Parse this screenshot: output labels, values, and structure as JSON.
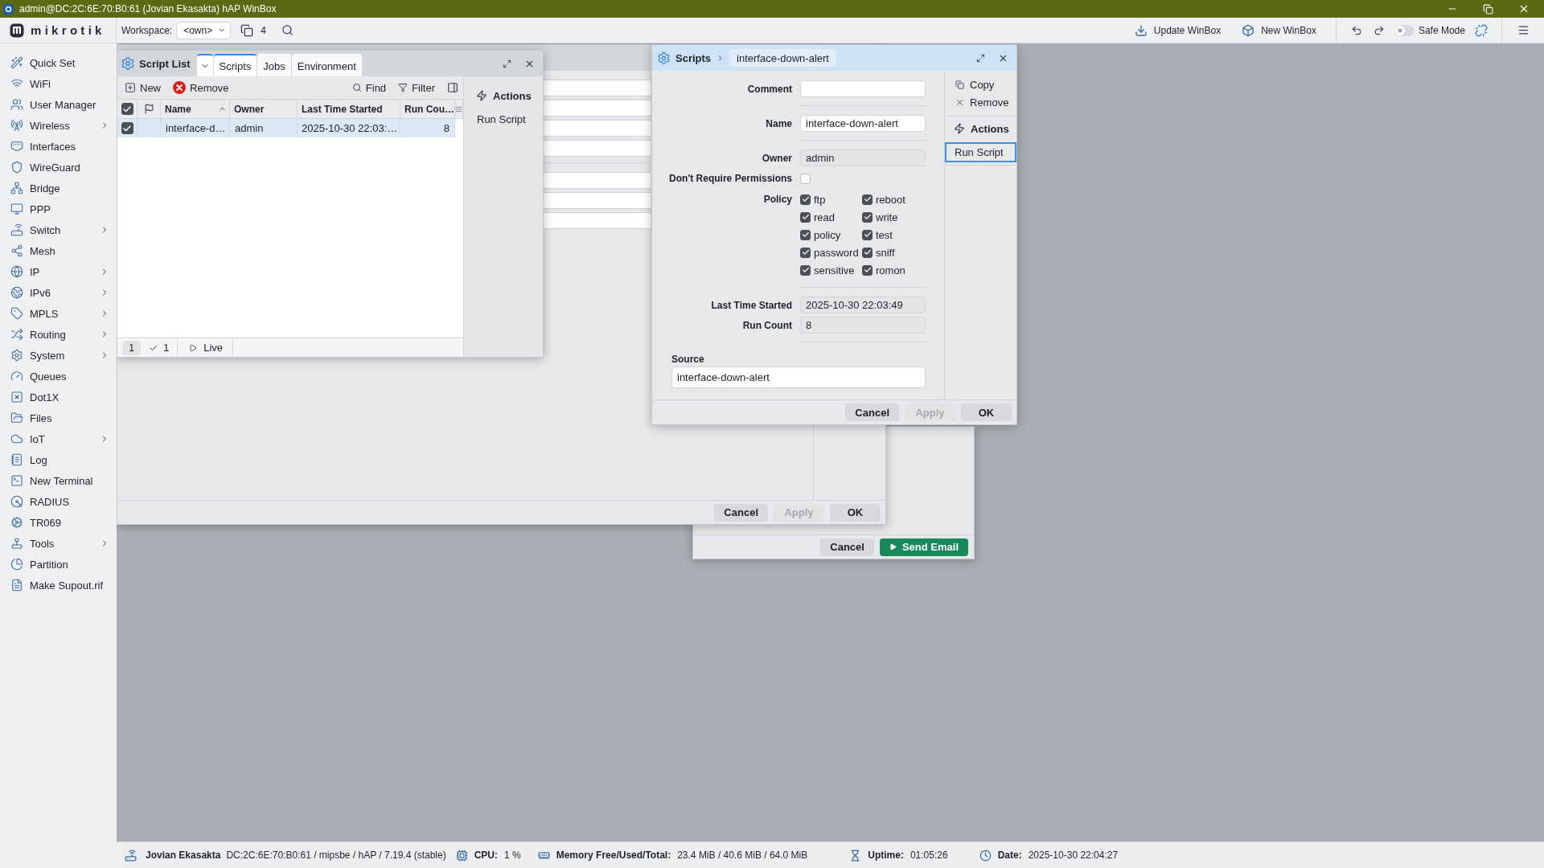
{
  "window": {
    "title": "admin@DC:2C:6E:70:B0:61 (Jovian Ekasakta) hAP WinBox"
  },
  "toolbar": {
    "logo": "mikrotik",
    "workspace_label": "Workspace:",
    "workspace": "<own>",
    "window_count": "4",
    "buttons": [
      {
        "label": "Update WinBox"
      },
      {
        "label": "New WinBox"
      }
    ],
    "safe_mode": {
      "label": "Safe Mode",
      "on": false
    }
  },
  "sidebar": {
    "items": [
      {
        "label": "Quick Set",
        "submenu": false
      },
      {
        "label": "WiFi",
        "submenu": false
      },
      {
        "label": "User Manager",
        "submenu": false
      },
      {
        "label": "Wireless",
        "submenu": true
      },
      {
        "label": "Interfaces",
        "submenu": false
      },
      {
        "label": "WireGuard",
        "submenu": false
      },
      {
        "label": "Bridge",
        "submenu": false
      },
      {
        "label": "PPP",
        "submenu": false
      },
      {
        "label": "Switch",
        "submenu": true
      },
      {
        "label": "Mesh",
        "submenu": false
      },
      {
        "label": "IP",
        "submenu": true
      },
      {
        "label": "IPv6",
        "submenu": true
      },
      {
        "label": "MPLS",
        "submenu": true
      },
      {
        "label": "Routing",
        "submenu": true
      },
      {
        "label": "System",
        "submenu": true
      },
      {
        "label": "Queues",
        "submenu": false
      },
      {
        "label": "Dot1X",
        "submenu": false
      },
      {
        "label": "Files",
        "submenu": false
      },
      {
        "label": "IoT",
        "submenu": true
      },
      {
        "label": "Log",
        "submenu": false
      },
      {
        "label": "New Terminal",
        "submenu": false
      },
      {
        "label": "RADIUS",
        "submenu": false
      },
      {
        "label": "TR069",
        "submenu": false
      },
      {
        "label": "Tools",
        "submenu": true
      },
      {
        "label": "Partition",
        "submenu": false
      },
      {
        "label": "Make Supout.rif",
        "submenu": false
      }
    ]
  },
  "background_windows": [
    {
      "kind": "form",
      "buttons": [
        {
          "label": "Cancel",
          "disabled": false
        },
        {
          "label": "Apply",
          "disabled": true
        },
        {
          "label": "OK",
          "disabled": false
        }
      ]
    },
    {
      "kind": "mail",
      "buttons": [
        {
          "label": "Cancel",
          "primary": false
        },
        {
          "label": "Send Email",
          "primary": true
        }
      ]
    }
  ],
  "script_list": {
    "title": "Script List",
    "tabs": [
      {
        "label": "Scripts",
        "selected": true
      },
      {
        "label": "Jobs",
        "selected": false
      },
      {
        "label": "Environment",
        "selected": false
      }
    ],
    "toolbar": [
      {
        "label": "New"
      },
      {
        "label": "Remove"
      }
    ],
    "toolbar_right": [
      {
        "label": "Find"
      },
      {
        "label": "Filter"
      }
    ],
    "header_checked": true,
    "columns": [
      {
        "label": "Name",
        "sorted": true
      },
      {
        "label": "Owner",
        "sorted": false
      },
      {
        "label": "Last Time Started",
        "sorted": false
      },
      {
        "label": "Run Cou…",
        "sorted": false
      }
    ],
    "rows": [
      {
        "selected": true,
        "checked": true,
        "cells": [
          "interface-d…",
          "admin",
          "2025-10-30 22:03:…",
          "8"
        ]
      }
    ],
    "footer": {
      "count": "1",
      "checked_count": "1",
      "live": "Live"
    },
    "actions_title": "Actions",
    "actions": [
      {
        "label": "Run Script"
      }
    ]
  },
  "script_editor": {
    "breadcrumb": "Scripts",
    "title": "interface-down-alert",
    "sections": [
      {
        "fields": [
          {
            "kind": "input",
            "label": "Comment"
          }
        ]
      },
      {
        "fields": [
          {
            "kind": "input",
            "label": "Name",
            "value": "interface-down-alert"
          }
        ]
      },
      {
        "fields": [
          {
            "kind": "readonly",
            "label": "Owner",
            "value": "admin"
          },
          {
            "kind": "checkbox",
            "label": "Don't Require Permissions",
            "checked": false
          },
          {
            "kind": "checklist",
            "label": "Policy",
            "options": [
              {
                "label": "ftp",
                "checked": true
              },
              {
                "label": "reboot",
                "checked": true
              },
              {
                "label": "read",
                "checked": true
              },
              {
                "label": "write",
                "checked": true
              },
              {
                "label": "policy",
                "checked": true
              },
              {
                "label": "test",
                "checked": true
              },
              {
                "label": "password",
                "checked": true
              },
              {
                "label": "sniff",
                "checked": true
              },
              {
                "label": "sensitive",
                "checked": true
              },
              {
                "label": "romon",
                "checked": true
              }
            ]
          }
        ]
      },
      {
        "fields": [
          {
            "kind": "readonly",
            "label": "Last Time Started",
            "value": "2025-10-30 22:03:49"
          },
          {
            "kind": "readonly",
            "label": "Run Count",
            "value": "8"
          }
        ]
      }
    ],
    "source": {
      "label": "Source",
      "value": "interface-down-alert"
    },
    "side_items": [
      {
        "label": "Copy"
      },
      {
        "label": "Remove"
      }
    ],
    "actions_title": "Actions",
    "actions": [
      {
        "label": "Run Script",
        "selected": true
      }
    ],
    "buttons": [
      {
        "label": "Cancel",
        "disabled": false
      },
      {
        "label": "Apply",
        "disabled": true
      },
      {
        "label": "OK",
        "disabled": false
      }
    ]
  },
  "status_bar": {
    "identity": "Jovian Ekasakta",
    "device": "DC:2C:6E:70:B0:61 / mipsbe / hAP / 7.19.4 (stable)",
    "items": [
      {
        "label": "CPU:",
        "value": "1 %"
      },
      {
        "label": "Memory Free/Used/Total:",
        "value": "23.4 MiB / 40.6 MiB / 64.0 MiB"
      },
      {
        "label": "Uptime:",
        "value": "01:05:26"
      },
      {
        "label": "Date:",
        "value": "2025-10-30 22:04:27"
      }
    ]
  }
}
